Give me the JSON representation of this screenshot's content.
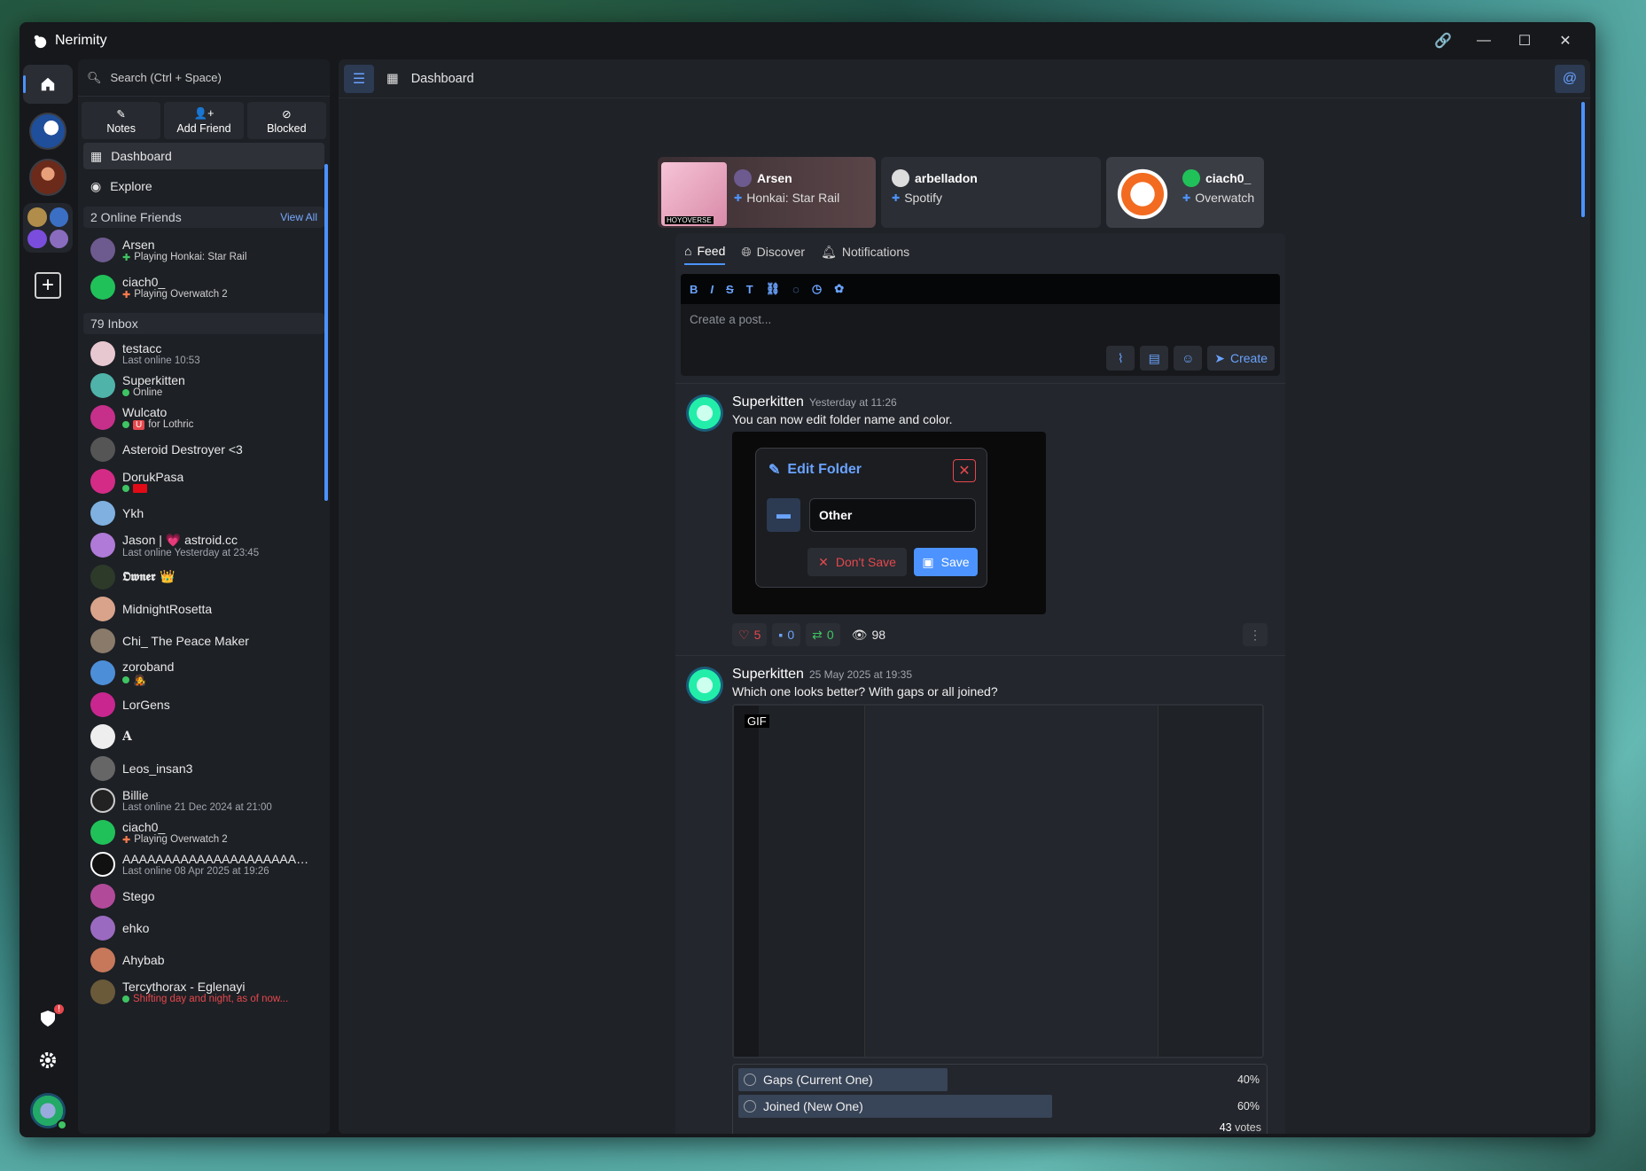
{
  "app": {
    "title": "Nerimity"
  },
  "header": {
    "title": "Dashboard"
  },
  "sidebar": {
    "search_placeholder": "Search (Ctrl + Space)",
    "actions": [
      {
        "label": "Notes",
        "icon": "notes-icon"
      },
      {
        "label": "Add Friend",
        "icon": "add-friend-icon"
      },
      {
        "label": "Blocked",
        "icon": "blocked-icon"
      }
    ],
    "nav": [
      {
        "label": "Dashboard",
        "icon": "dashboard-icon"
      },
      {
        "label": "Explore",
        "icon": "explore-icon"
      }
    ],
    "online_header": "2 Online Friends",
    "view_all": "View All",
    "online_friends": [
      {
        "name": "Arsen",
        "status": "Playing Honkai: Star Rail"
      },
      {
        "name": "ciach0_",
        "status": "Playing Overwatch 2"
      }
    ],
    "inbox_header": "79 Inbox",
    "inbox": [
      {
        "name": "testacc",
        "status": "Last online 10:53"
      },
      {
        "name": "Superkitten",
        "status": "Online"
      },
      {
        "name": "Wulcato",
        "status": "for Lothric"
      },
      {
        "name": "Asteroid Destroyer <3",
        "status": ""
      },
      {
        "name": "DorukPasa",
        "status": ""
      },
      {
        "name": "Ykh",
        "status": ""
      },
      {
        "name": "Jason | 💗 astroid.cc",
        "status": "Last online Yesterday at 23:45"
      },
      {
        "name": "𝕺𝖜𝖓𝖊𝖗 👑",
        "status": ""
      },
      {
        "name": "MidnightRosetta",
        "status": ""
      },
      {
        "name": "Chi_ The Peace Maker",
        "status": ""
      },
      {
        "name": "zoroband",
        "status": ""
      },
      {
        "name": "LorGens",
        "status": ""
      },
      {
        "name": "A",
        "status": ""
      },
      {
        "name": "Leos_insan3",
        "status": ""
      },
      {
        "name": "Billie",
        "status": "Last online 21 Dec 2024 at 21:00"
      },
      {
        "name": "ciach0_",
        "status": "Playing Overwatch 2"
      },
      {
        "name": "AAAAAAAAAAAAAAAAAAAAAAAAAAA",
        "status": "Last online 08 Apr 2025 at 19:26"
      },
      {
        "name": "Stego",
        "status": ""
      },
      {
        "name": "ehko",
        "status": ""
      },
      {
        "name": "Ahybab",
        "status": ""
      },
      {
        "name": "Tercythorax - Eglenayi",
        "status": "Shifting day and night, as of now..."
      }
    ]
  },
  "activities": [
    {
      "name": "Arsen",
      "game": "Honkai: Star Rail",
      "art_label": "HOYOVERSE"
    },
    {
      "name": "arbelladon",
      "game": "Spotify"
    },
    {
      "name": "ciach0_",
      "game": "Overwatch"
    }
  ],
  "feed": {
    "tabs": [
      {
        "label": "Feed",
        "icon": "home-icon"
      },
      {
        "label": "Discover",
        "icon": "globe-icon"
      },
      {
        "label": "Notifications",
        "icon": "bell-icon"
      }
    ],
    "toolbar": [
      "B",
      "I",
      "S",
      "T",
      "link",
      "spoiler",
      "timestamp",
      "color"
    ],
    "composer_placeholder": "Create a post...",
    "create_label": "Create"
  },
  "posts": [
    {
      "author": "Superkitten",
      "time": "Yesterday at 11:26",
      "text": "You can now edit folder name and color.",
      "dialog": {
        "title": "Edit Folder",
        "input_value": "Other",
        "dont_save": "Don't Save",
        "save": "Save"
      },
      "likes": "5",
      "comments": "0",
      "reposts": "0",
      "views": "98"
    },
    {
      "author": "Superkitten",
      "time": "25 May 2025 at 19:35",
      "text": "Which one looks better? With gaps or all joined?",
      "gif_label": "GIF",
      "poll": {
        "options": [
          {
            "label": "Gaps (Current One)",
            "percent": "40%",
            "fraction": 0.4
          },
          {
            "label": "Joined (New One)",
            "percent": "60%",
            "fraction": 0.6
          }
        ],
        "votes_count": "43",
        "votes_label": "votes"
      }
    }
  ],
  "colors": {
    "accent": "#4c93ff",
    "danger": "#e5484d",
    "online": "#3fc463"
  }
}
